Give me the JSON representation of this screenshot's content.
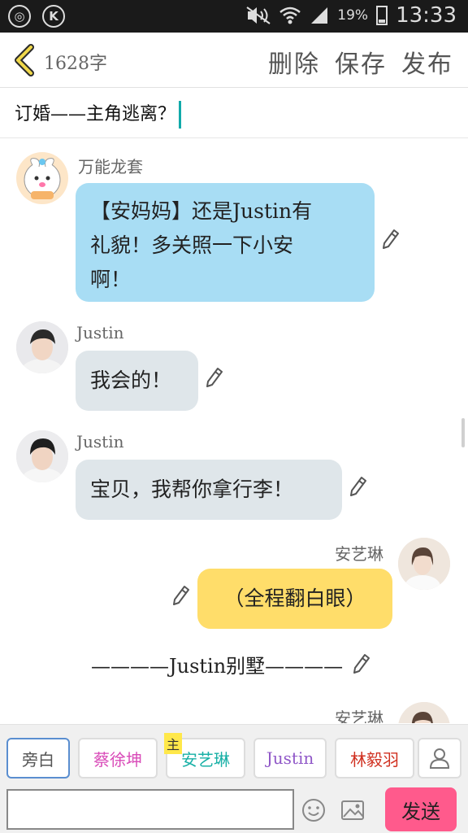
{
  "status_bar": {
    "battery": "19%",
    "time": "13:33"
  },
  "header": {
    "word_count": "1628字",
    "delete_label": "删除",
    "save_label": "保存",
    "publish_label": "发布"
  },
  "title": "订婚——主角逃离？",
  "messages": [
    {
      "speaker": "万能龙套",
      "text_lines": [
        "【安妈妈】还是Justin有",
        "礼貌！多关照一下小安",
        "啊！"
      ],
      "bubble_color": "#a8ddf4"
    },
    {
      "speaker": "Justin",
      "text_lines": [
        "我会的！"
      ],
      "bubble_color": "#dfe6ea"
    },
    {
      "speaker": "Justin",
      "text_lines": [
        "宝贝，我帮你拿行李！"
      ],
      "bubble_color": "#dfe6ea"
    },
    {
      "speaker": "安艺琳",
      "text_lines": [
        "（全程翻白眼）"
      ],
      "bubble_color": "#ffdd6a"
    },
    {
      "speaker": "安艺琳"
    }
  ],
  "narration": "————Justin别墅————",
  "roles": [
    {
      "label": "旁白",
      "color": "#555555",
      "selected": true
    },
    {
      "label": "蔡徐坤",
      "color": "#d94ab8"
    },
    {
      "label": "安艺琳",
      "color": "#18b0a6",
      "tag": "主"
    },
    {
      "label": "Justin",
      "color": "#9058c8"
    },
    {
      "label": "林毅羽",
      "color": "#d03020"
    }
  ],
  "input": {
    "value": "",
    "placeholder": ""
  },
  "send_label": "发送",
  "icons": [
    "weibo-icon",
    "k-icon",
    "mute-icon",
    "wifi-icon",
    "signal-icon",
    "battery-icon",
    "back-chevron-icon",
    "pencil-icon",
    "person-icon",
    "emoji-icon",
    "image-icon"
  ]
}
